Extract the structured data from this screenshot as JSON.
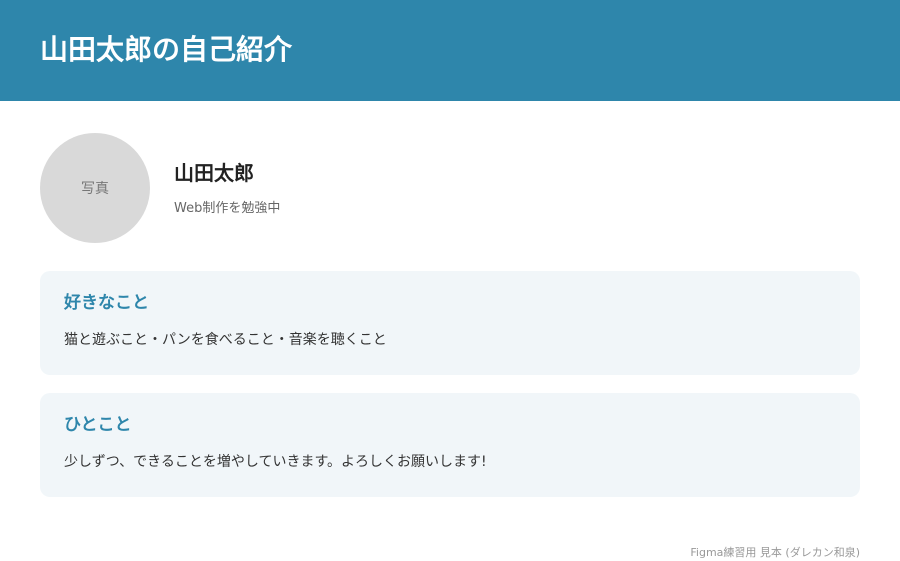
{
  "header": {
    "title": "山田太郎の自己紹介"
  },
  "profile": {
    "photo_label": "写真",
    "name": "山田太郎",
    "tagline": "Web制作を勉強中"
  },
  "sections": [
    {
      "title": "好きなこと",
      "body": "猫と遊ぶこと・パンを食べること・音楽を聴くこと"
    },
    {
      "title": "ひとこと",
      "body": "少しずつ、できることを増やしていきます。よろしくお願いします!"
    }
  ],
  "footer": {
    "credit": "Figma練習用 見本 (ダレカン和泉)"
  },
  "colors": {
    "header_bg": "#2e86ab",
    "card_bg": "#f1f6f9",
    "accent": "#2e86ab",
    "avatar_bg": "#d9d9d9"
  }
}
